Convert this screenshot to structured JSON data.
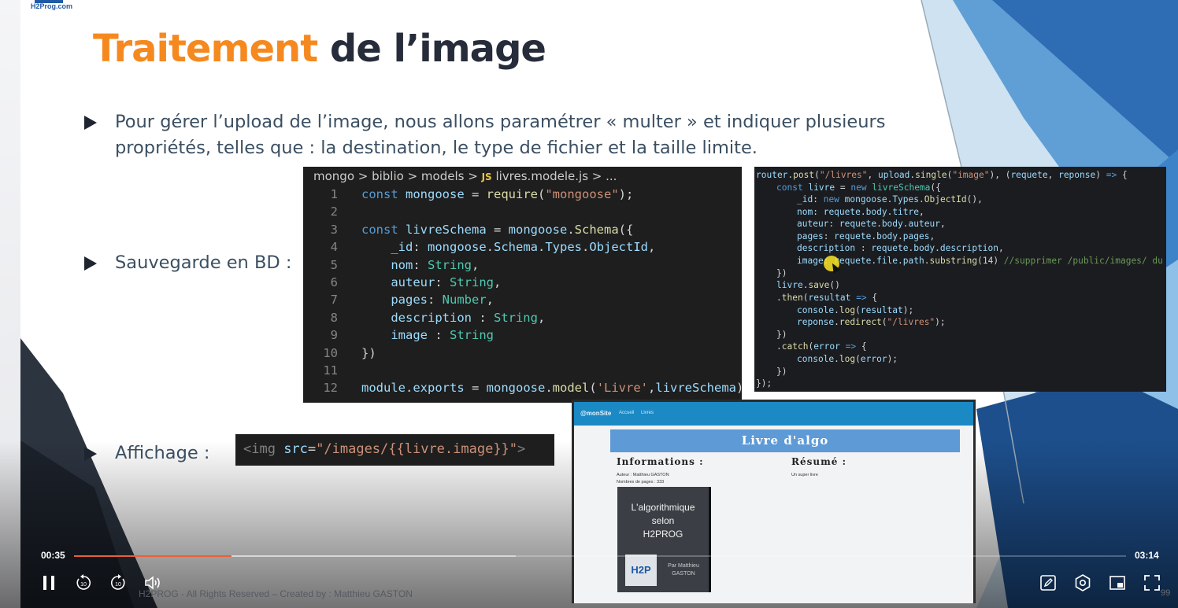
{
  "logo": {
    "text": "H2Prog.com",
    "color": "#1f5aa6"
  },
  "slide": {
    "title_part1": "Traitement",
    "title_part2": "de l’image",
    "title_colors": {
      "accent": "#f5891f",
      "dark": "#262c3a"
    },
    "bullets": [
      {
        "line1": "Pour gérer l’upload de l’image, nous allons paramétrer « multer » et indiquer plusieurs",
        "line2": "propriétés, telles que : la destination, le type de fichier et la taille limite."
      },
      {
        "line1": "Sauvegarde en BD :"
      },
      {
        "line1": "Affichage :"
      }
    ],
    "footer": "H2PROG - All Rights Reserved – Created by : Matthieu GASTON",
    "slide_number": "99"
  },
  "editor": {
    "breadcrumb": "mongo > biblio > models >",
    "file_badge": "JS",
    "file_name": "livres.modele.js > ...",
    "line_numbers": [
      "1",
      "2",
      "3",
      "4",
      "5",
      "6",
      "7",
      "8",
      "9",
      "10",
      "11",
      "12"
    ]
  },
  "display_code": {
    "text": "<img src=\"/images/{{livre.image}}\">"
  },
  "screenshot": {
    "brand": "@monSite",
    "nav_links": [
      "Accueil",
      "Livres"
    ],
    "banner": "Livre d'algo",
    "info_heading": "Informations :",
    "summary_heading": "Résumé :",
    "author_line": "Auteur : Matthieu GASTON",
    "pages_line": "Nombres de pages : 333",
    "summary_text": "Un super livre",
    "book_title_lines": [
      "L'algorithmique",
      "selon",
      "H2PROG"
    ],
    "book_logo": "H2P",
    "book_author": "Par Matthieu GASTON"
  },
  "player": {
    "current_time": "00:35",
    "duration": "03:14",
    "progress_fraction": 0.15,
    "buffered_fraction": 0.42,
    "accent_color": "#e8603a",
    "left_controls": [
      "pause-icon",
      "rewind-10-icon",
      "forward-10-icon",
      "volume-icon"
    ],
    "right_controls": [
      "annotate-icon",
      "settings-icon",
      "picture-in-picture-icon",
      "fullscreen-icon"
    ],
    "skip_seconds": "10"
  }
}
